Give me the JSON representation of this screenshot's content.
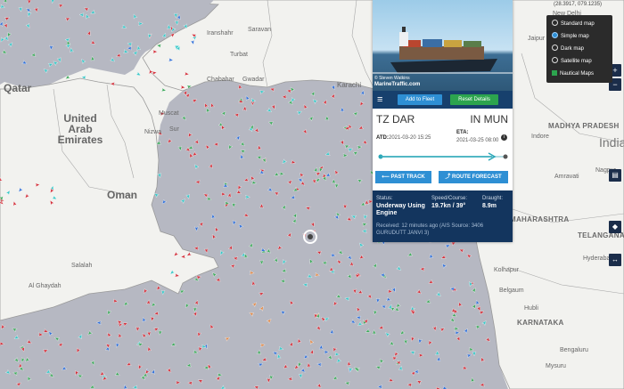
{
  "colors": {
    "sea": "#b6b8c2",
    "land": "#f2f2ef",
    "tanker": "#d32f3a",
    "cargo": "#3ca85a",
    "passenger": "#2f6fd8",
    "fishing": "#e08a4a",
    "tug": "#36c7c7",
    "panel_dark": "#13355e",
    "toolbar": "#17406d",
    "accent": "#2e8fd4",
    "green": "#2ca44e"
  },
  "map": {
    "coords": "(28.3917, 079.1235)",
    "labels": {
      "qatar": "Qatar",
      "uae": "United Arab Emirates",
      "oman": "Oman",
      "india": "India",
      "karachi": "Karachi",
      "iranshahr": "Iranshahr",
      "saravan": "Saravan",
      "turbat": "Turbat",
      "chabahar": "Chabahar",
      "gwadar": "Gwadar",
      "sur": "Sur",
      "nizwa": "Nizwa",
      "muscat": "Muscat",
      "salalah": "Salalah",
      "alghaydah": "Al Ghaydah",
      "newdelhi": "New Delhi",
      "jaipur": "Jaipur",
      "madhya_pradesh": "MADHYA PRADESH",
      "indore": "Indore",
      "nagpur": "Nagpur",
      "amravati": "Amravati",
      "maharashtra": "MAHARASHTRA",
      "telangana": "TELANGANA",
      "hyderabad": "Hyderabad",
      "kolhapur": "Kolhapur",
      "belgaum": "Belgaum",
      "hubli": "Hubli",
      "karnataka": "KARNATAKA",
      "bengaluru": "Bengaluru",
      "mysuru": "Mysuru"
    },
    "controls": {
      "zoom_in": "+",
      "zoom_out": "−"
    }
  },
  "layers": {
    "items": [
      {
        "label": "Standard map",
        "selected": false
      },
      {
        "label": "Simple map",
        "selected": true
      },
      {
        "label": "Dark map",
        "selected": false
      },
      {
        "label": "Satellite map",
        "selected": false
      },
      {
        "label": "Nautical Maps",
        "selected": false
      }
    ]
  },
  "vessel": {
    "photo_credit": "© Steven Watkins",
    "watermark": "MarineTraffic.com",
    "add_to_fleet": "Add to Fleet",
    "reset_details": "Reset Details",
    "departure_port": "TZ DAR",
    "arrival_port": "IN MUN",
    "atd_label": "ATD:",
    "atd_value": "2021-03-20 15:25",
    "eta_label": "ETA:",
    "eta_value": "2021-03-25 08:00",
    "past_track": "PAST TRACK",
    "route_forecast": "ROUTE FORECAST",
    "status_label": "Status:",
    "status_value": "Underway Using Engine",
    "speed_label": "Speed/Course:",
    "speed_value": "19.7kn / 39°",
    "draught_label": "Draught:",
    "draught_value": "8.9m",
    "received": "Received: 12 minutes ago (AIS Source: 3406 GURUDUTT JANVI 3)"
  }
}
